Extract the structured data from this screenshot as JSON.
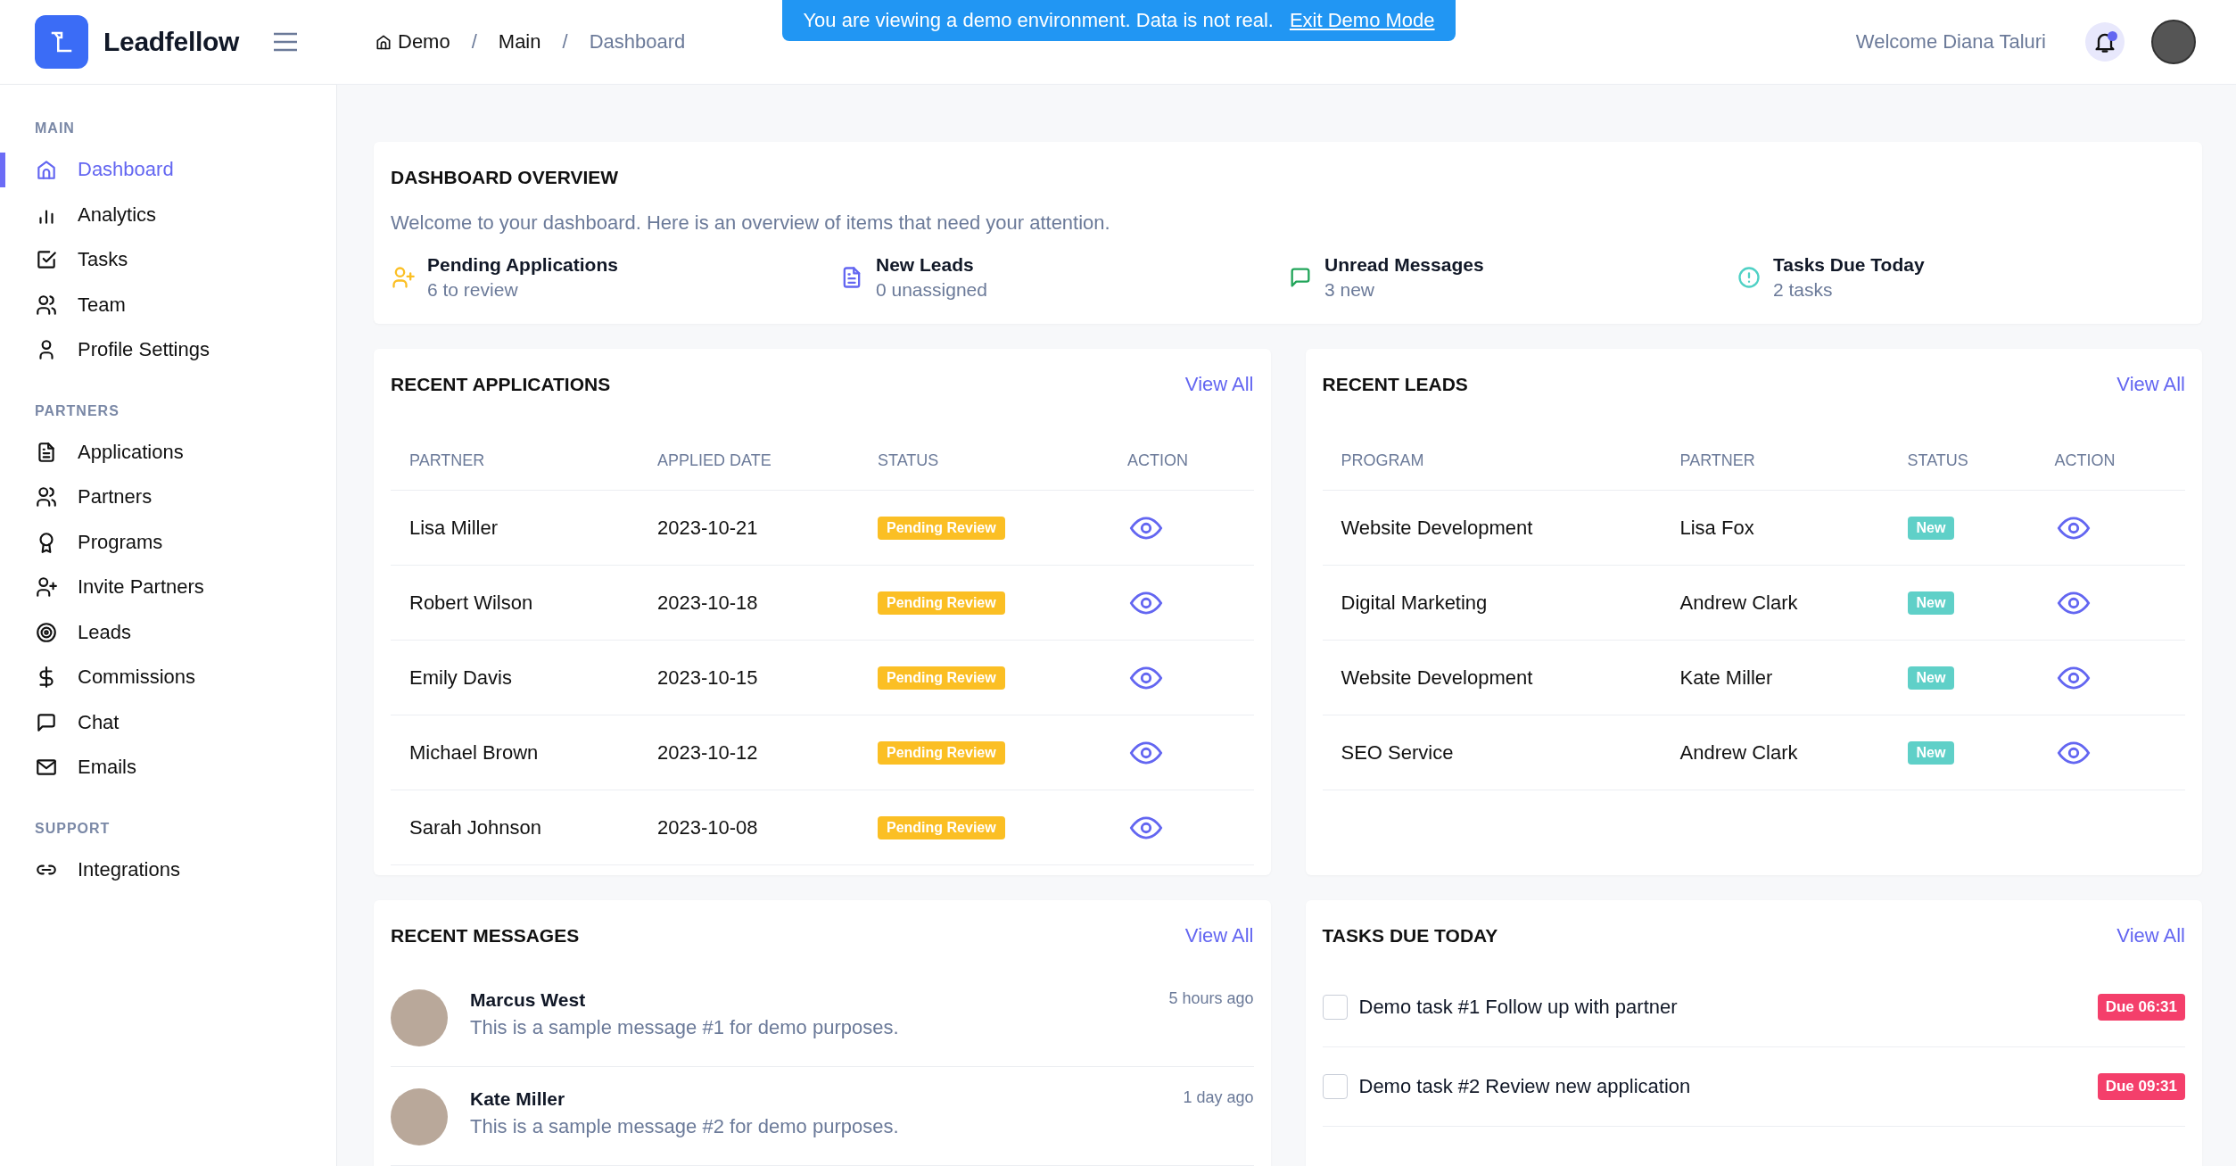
{
  "header": {
    "logo": "Leadfellow",
    "breadcrumb": [
      {
        "label": "Demo",
        "current": false
      },
      {
        "label": "Main",
        "current": false
      },
      {
        "label": "Dashboard",
        "current": true
      }
    ],
    "breadcrumb_separators": [
      "/",
      "/"
    ],
    "demo_banner": {
      "text": "You are viewing a demo environment. Data is not real.",
      "link": "Exit Demo Mode"
    },
    "welcome": "Welcome Diana Taluri",
    "notifications": {
      "unread": true
    }
  },
  "sidebar": {
    "sections": [
      {
        "title": "MAIN",
        "items": [
          {
            "label": "Dashboard",
            "selected": true
          },
          {
            "label": "Analytics",
            "selected": false
          },
          {
            "label": "Tasks",
            "selected": false
          },
          {
            "label": "Team",
            "selected": false
          },
          {
            "label": "Profile Settings",
            "selected": false
          }
        ]
      },
      {
        "title": "PARTNERS",
        "items": [
          {
            "label": "Applications",
            "selected": false
          },
          {
            "label": "Partners",
            "selected": false
          },
          {
            "label": "Programs",
            "selected": false
          },
          {
            "label": "Invite Partners",
            "selected": false
          },
          {
            "label": "Leads",
            "selected": false
          },
          {
            "label": "Commissions",
            "selected": false
          },
          {
            "label": "Chat",
            "selected": false
          },
          {
            "label": "Emails",
            "selected": false
          }
        ]
      },
      {
        "title": "SUPPORT",
        "items": [
          {
            "label": "Integrations",
            "selected": false
          }
        ]
      }
    ]
  },
  "overview": {
    "title": "DASHBOARD OVERVIEW",
    "intro": "Welcome to your dashboard. Here is an overview of items that need your attention.",
    "stats": [
      {
        "label": "Pending Applications",
        "detail": "6 to review",
        "color": "#fbbf24"
      },
      {
        "label": "New Leads",
        "detail": "0 unassigned",
        "color": "#6366f1"
      },
      {
        "label": "Unread Messages",
        "detail": "3 new",
        "color": "#22a55a"
      },
      {
        "label": "Tasks Due Today",
        "detail": "2 tasks",
        "color": "#4fd1c5"
      }
    ]
  },
  "recent_applications": {
    "title": "RECENT APPLICATIONS",
    "view_all": "View All",
    "columns": [
      "PARTNER",
      "APPLIED DATE",
      "STATUS",
      "ACTION"
    ],
    "rows": [
      {
        "partner": "Lisa Miller",
        "applied_date": "2023-10-21",
        "status": "Pending Review"
      },
      {
        "partner": "Robert Wilson",
        "applied_date": "2023-10-18",
        "status": "Pending Review"
      },
      {
        "partner": "Emily Davis",
        "applied_date": "2023-10-15",
        "status": "Pending Review"
      },
      {
        "partner": "Michael Brown",
        "applied_date": "2023-10-12",
        "status": "Pending Review"
      },
      {
        "partner": "Sarah Johnson",
        "applied_date": "2023-10-08",
        "status": "Pending Review"
      }
    ]
  },
  "recent_leads": {
    "title": "RECENT LEADS",
    "view_all": "View All",
    "columns": [
      "PROGRAM",
      "PARTNER",
      "STATUS",
      "ACTION"
    ],
    "rows": [
      {
        "program": "Website Development",
        "partner": "Lisa Fox",
        "status": "New"
      },
      {
        "program": "Digital Marketing",
        "partner": "Andrew Clark",
        "status": "New"
      },
      {
        "program": "Website Development",
        "partner": "Kate Miller",
        "status": "New"
      },
      {
        "program": "SEO Service",
        "partner": "Andrew Clark",
        "status": "New"
      }
    ]
  },
  "recent_messages": {
    "title": "RECENT MESSAGES",
    "view_all": "View All",
    "messages": [
      {
        "sender": "Marcus West",
        "text": "This is a sample message #1 for demo purposes.",
        "time": "5 hours ago"
      },
      {
        "sender": "Kate Miller",
        "text": "This is a sample message #2 for demo purposes.",
        "time": "1 day ago"
      }
    ]
  },
  "tasks_due_today": {
    "title": "TASKS DUE TODAY",
    "view_all": "View All",
    "tasks": [
      {
        "label": "Demo task #1 Follow up with partner",
        "due": "Due 06:31",
        "checked": false
      },
      {
        "label": "Demo task #2 Review new application",
        "due": "Due 09:31",
        "checked": false
      }
    ]
  }
}
